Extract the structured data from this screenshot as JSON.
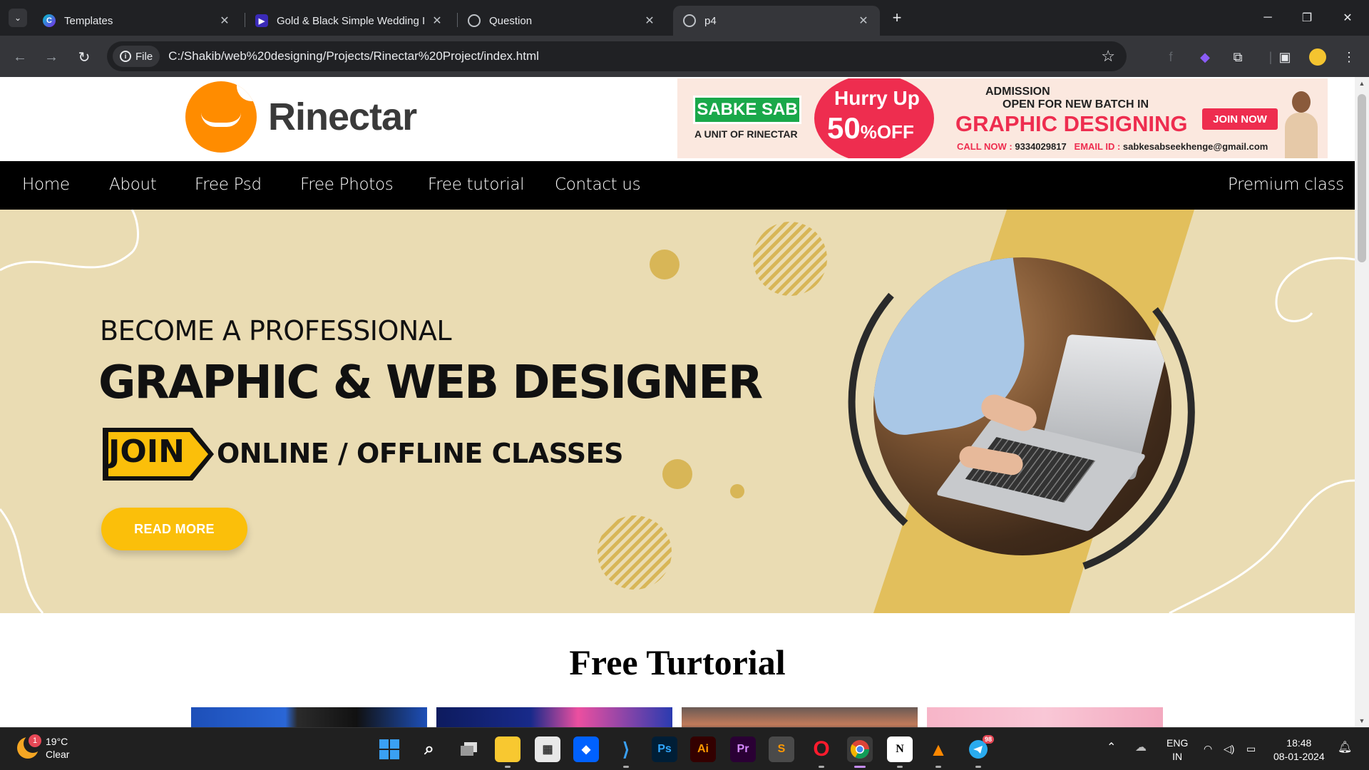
{
  "browser": {
    "tabs": [
      {
        "title": "Templates",
        "favicon": "canva-icon",
        "active": false
      },
      {
        "title": "Gold & Black Simple Wedding I",
        "favicon": "video-icon",
        "active": false
      },
      {
        "title": "Question",
        "favicon": "globe-icon",
        "active": false
      },
      {
        "title": "p4",
        "favicon": "globe-icon",
        "active": true
      }
    ],
    "address": {
      "scheme_chip": "File",
      "url": "C:/Shakib/web%20designing/Projects/Rinectar%20Project/index.html"
    },
    "icons": {
      "new_tab": "+",
      "back": "←",
      "forward": "→",
      "reload": "↻",
      "bookmark": "☆"
    }
  },
  "site": {
    "logo_text": "Rinectar",
    "ad": {
      "brand": "SABKE SAB",
      "unit": "A UNIT OF RINECTAR",
      "hurry": "Hurry Up",
      "discount": "50",
      "discount_suffix": "%OFF",
      "admission": "ADMISSION",
      "open": "OPEN FOR NEW BATCH IN",
      "course": "GRAPHIC DESIGNING",
      "join": "JOIN NOW",
      "call_label": "CALL NOW :",
      "call_number": "9334029817",
      "email_label": "EMAIL ID :",
      "email": "sabkesabseekhenge@gmail.com"
    },
    "nav": {
      "items": [
        "Home",
        "About",
        "Free Psd",
        "Free Photos",
        "Free tutorial",
        "Contact us"
      ],
      "right": "Premium class"
    },
    "hero": {
      "line1": "BECOME A PROFESSIONAL",
      "line2": "GRAPHIC & WEB DESIGNER",
      "join": "JOIN",
      "line3": "ONLINE / OFFLINE CLASSES",
      "cta": "READ MORE"
    },
    "section_title": "Free Turtorial",
    "colors": {
      "accent": "#fbbf0a",
      "hero_bg": "#eadcb3",
      "nav_bg": "#000000",
      "logo": "#ff8c00"
    }
  },
  "taskbar": {
    "weather": {
      "temp": "19°C",
      "condition": "Clear",
      "badge": "1"
    },
    "apps": [
      "windows-start",
      "search",
      "task-view",
      "file-explorer",
      "microsoft-store",
      "dropbox",
      "vscode",
      "photoshop",
      "illustrator",
      "premiere",
      "sublime-text",
      "opera",
      "chrome",
      "notion",
      "vlc",
      "telegram"
    ],
    "telegram_badge": "98",
    "lang": "ENG",
    "region": "IN",
    "time": "18:48",
    "date": "08-01-2024"
  }
}
